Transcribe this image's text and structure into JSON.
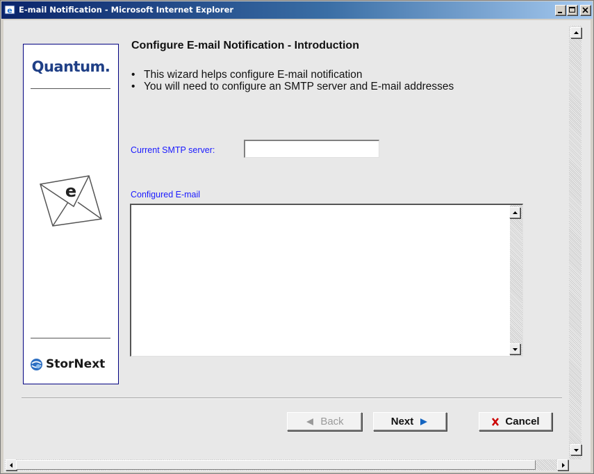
{
  "window": {
    "title": "E-mail Notification - Microsoft Internet Explorer",
    "controls": [
      "minimize-icon",
      "maximize-icon",
      "close-icon"
    ]
  },
  "sidebar": {
    "brand_logo": "Quantum.",
    "product_logo": "StorNext",
    "envelope_letter": "e"
  },
  "page": {
    "heading": "Configure E-mail Notification - Introduction",
    "bullets": [
      "This wizard helps configure E-mail notification",
      "You will need to configure an SMTP server and E-mail addresses"
    ],
    "smtp_label": "Current SMTP server:",
    "smtp_value": "",
    "email_label": "Configured E-mail",
    "email_value": ""
  },
  "buttons": {
    "back": "Back",
    "next": "Next",
    "cancel": "Cancel"
  },
  "colors": {
    "title_bar": "#0a246a",
    "label_blue": "#1a1aff",
    "brand_blue": "#1f3f86",
    "cancel_x": "#cc0000",
    "arrow_blue": "#1565c0"
  }
}
